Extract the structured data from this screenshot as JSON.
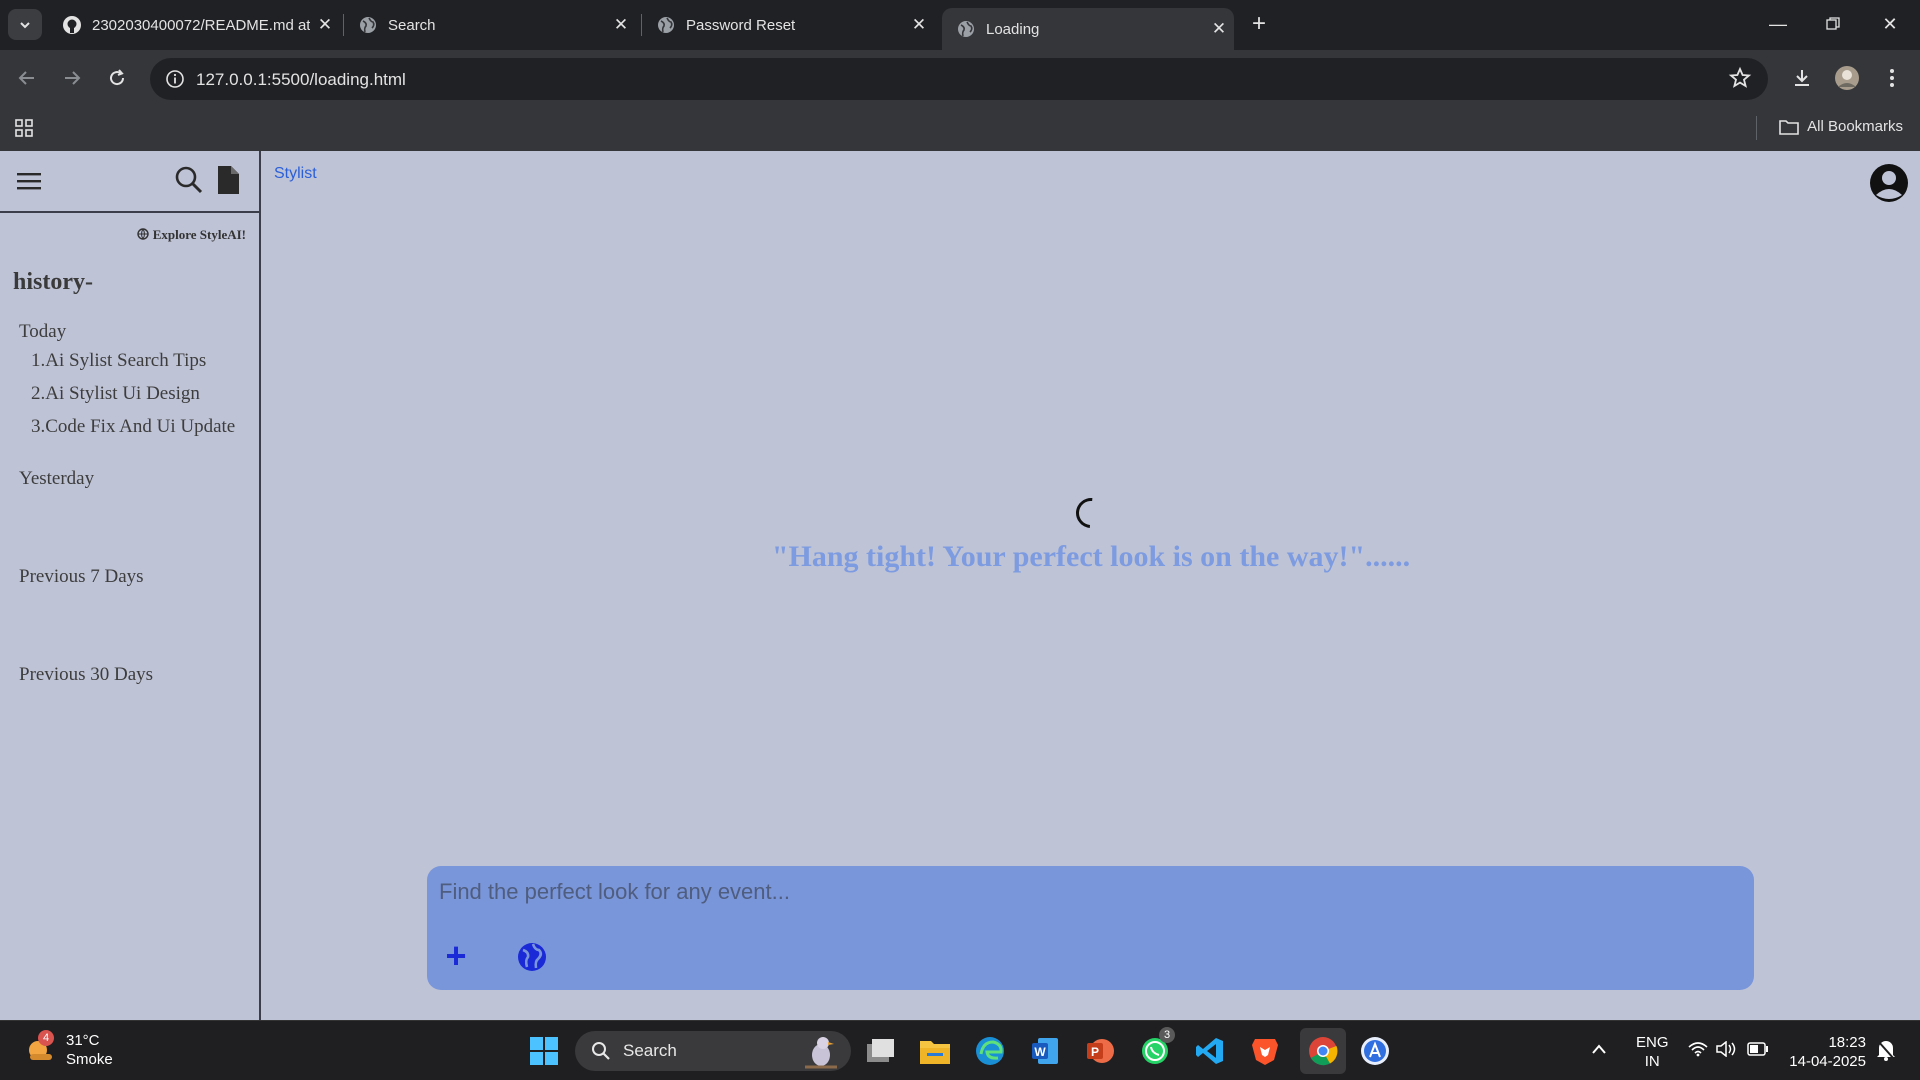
{
  "browser": {
    "tabs": [
      {
        "title": "2302030400072/README.md at",
        "icon": "github-icon",
        "active": false
      },
      {
        "title": "Search",
        "icon": "globe-icon",
        "active": false
      },
      {
        "title": "Password Reset",
        "icon": "globe-icon",
        "active": false
      },
      {
        "title": "Loading",
        "icon": "globe-icon",
        "active": true
      }
    ],
    "url": "127.0.0.1:5500/loading.html",
    "all_bookmarks": "All Bookmarks"
  },
  "sidebar": {
    "explore": "Explore StyleAI!",
    "history_title": "history-",
    "groups": [
      {
        "label": "Today",
        "items": [
          "1.Ai Sylist Search Tips",
          "2.Ai Stylist Ui Design",
          "3.Code Fix And Ui Update"
        ]
      },
      {
        "label": "Yesterday",
        "items": []
      },
      {
        "label": "Previous 7 Days",
        "items": []
      },
      {
        "label": "Previous 30 Days",
        "items": []
      }
    ]
  },
  "header": {
    "brand": "Stylist"
  },
  "main": {
    "loading_message": "\"Hang tight! Your perfect look is on the way!\"......"
  },
  "chat": {
    "placeholder": "Find the perfect look for any event...",
    "add_label": "+"
  },
  "taskbar": {
    "weather_temp": "31°C",
    "weather_desc": "Smoke",
    "weather_badge": "4",
    "search_label": "Search",
    "whatsapp_badge": "3",
    "lang_top": "ENG",
    "lang_bottom": "IN",
    "time": "18:23",
    "date": "14-04-2025"
  },
  "colors": {
    "page_bg": "#bec3d6",
    "chat_bg": "#7a96da",
    "loading_text": "#7d9be0",
    "brand_link": "#2b5fd9"
  }
}
